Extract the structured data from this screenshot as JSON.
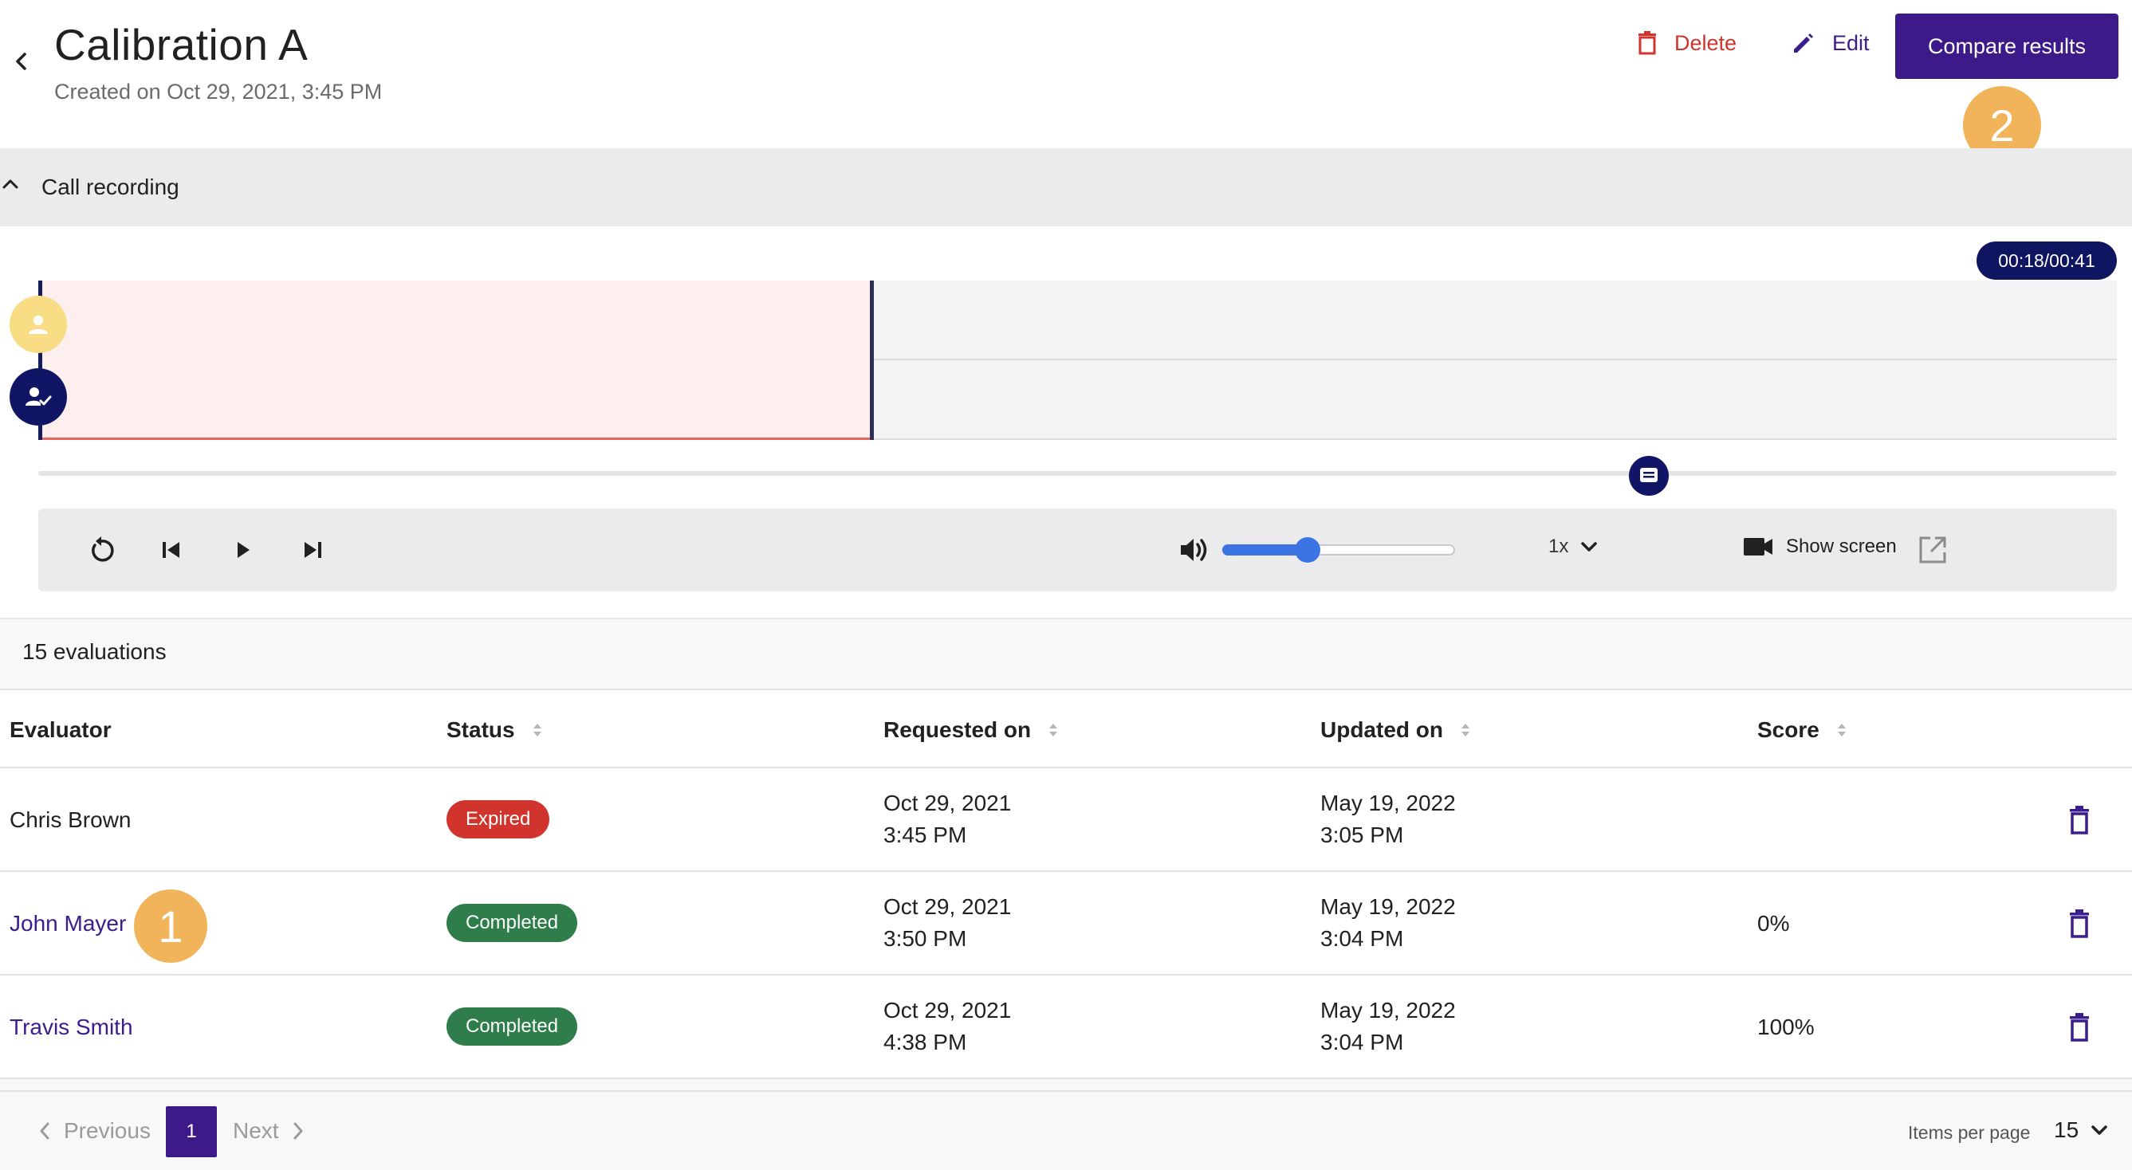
{
  "header": {
    "title": "Calibration A",
    "subtitle": "Created on Oct 29, 2021, 3:45 PM",
    "delete_label": "Delete",
    "edit_label": "Edit",
    "compare_label": "Compare results"
  },
  "callouts": {
    "one": "1",
    "two": "2"
  },
  "recording": {
    "section_title": "Call recording",
    "time_display": "00:18/00:41",
    "played_fraction": 0.4,
    "volume_fraction": 0.37,
    "speed": "1x",
    "show_screen_label": "Show screen"
  },
  "evaluations": {
    "count_label": "15 evaluations",
    "columns": {
      "evaluator": "Evaluator",
      "status": "Status",
      "requested": "Requested on",
      "updated": "Updated on",
      "score": "Score"
    },
    "rows": [
      {
        "evaluator": "Chris Brown",
        "status": "Expired",
        "requested_date": "Oct 29, 2021",
        "requested_time": "3:45 PM",
        "updated_date": "May 19, 2022",
        "updated_time": "3:05 PM",
        "score": ""
      },
      {
        "evaluator": "John Mayer",
        "status": "Completed",
        "requested_date": "Oct 29, 2021",
        "requested_time": "3:50 PM",
        "updated_date": "May 19, 2022",
        "updated_time": "3:04 PM",
        "score": "0%"
      },
      {
        "evaluator": "Travis Smith",
        "status": "Completed",
        "requested_date": "Oct 29, 2021",
        "requested_time": "4:38 PM",
        "updated_date": "May 19, 2022",
        "updated_time": "3:04 PM",
        "score": "100%"
      }
    ]
  },
  "pagination": {
    "previous_label": "Previous",
    "current_page": "1",
    "next_label": "Next",
    "items_per_page_label": "Items per page",
    "items_per_page": "15"
  },
  "colors": {
    "primary": "#3d1a8a",
    "danger": "#d0342c",
    "success": "#2e7d4a",
    "callout": "#f2b45a",
    "navy": "#111565",
    "volume": "#3d74e4"
  }
}
